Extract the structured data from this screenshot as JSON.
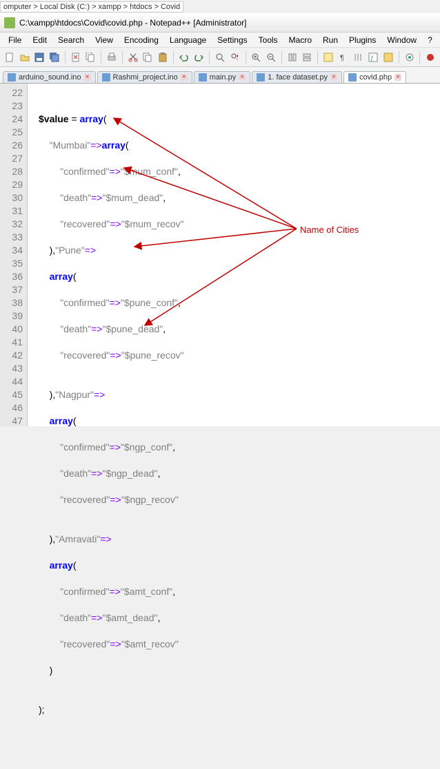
{
  "breadcrumb": "omputer > Local Disk (C:) > xampp > htdocs > Covid",
  "window": {
    "title": "C:\\xampp\\htdocs\\Covid\\covid.php - Notepad++ [Administrator]"
  },
  "menu": {
    "file": "File",
    "edit": "Edit",
    "search": "Search",
    "view": "View",
    "encoding": "Encoding",
    "language": "Language",
    "settings": "Settings",
    "tools": "Tools",
    "macro": "Macro",
    "run": "Run",
    "plugins": "Plugins",
    "window": "Window",
    "help": "?"
  },
  "tabs": {
    "t1": "arduino_sound.ino",
    "t2": "Rashmi_project.ino",
    "t3": "main.py",
    "t4": "1. face dataset.py",
    "t5": "covid.php"
  },
  "lines": {
    "l22": "22",
    "l23": "23",
    "l24": "24",
    "l25": "25",
    "l26": "26",
    "l27": "27",
    "l28": "28",
    "l29": "29",
    "l30": "30",
    "l31": "31",
    "l32": "32",
    "l33": "33",
    "l34": "34",
    "l35": "35",
    "l36": "36",
    "l37": "37",
    "l38": "38",
    "l39": "39",
    "l40": "40",
    "l41": "41",
    "l42": "42",
    "l43": "43",
    "l44": "44",
    "l45": "45",
    "l46": "46",
    "l47": "47"
  },
  "code": {
    "var": "$value",
    "eq": " = ",
    "array": "array",
    "op_arrow": "=>",
    "lp": "(",
    "rp": ")",
    "comma": ",",
    "semi": ";",
    "mumbai": "\"Mumbai\"",
    "pune": "\"Pune\"",
    "nagpur": "\"Nagpur\"",
    "amravati": "\"Amravati\"",
    "confirmed": "\"confirmed\"",
    "death": "\"death\"",
    "recovered": "\"recovered\"",
    "mum_conf": "\"$mum_conf\"",
    "mum_dead": "\"$mum_dead\"",
    "mum_recov": "\"$mum_recov\"",
    "pune_conf": "\"$pune_conf\"",
    "pune_dead": "\"$pune_dead\"",
    "pune_recov": "\"$pune_recov\"",
    "ngp_conf": "\"$ngp_conf\"",
    "ngp_dead": "\"$ngp_dead\"",
    "ngp_recov": "\"$ngp_recov\"",
    "amt_conf": "\"$amt_conf\"",
    "amt_dead": "\"$amt_dead\"",
    "amt_recov": "\"$amt_recov\""
  },
  "annotation": {
    "label": "Name of Cities"
  }
}
